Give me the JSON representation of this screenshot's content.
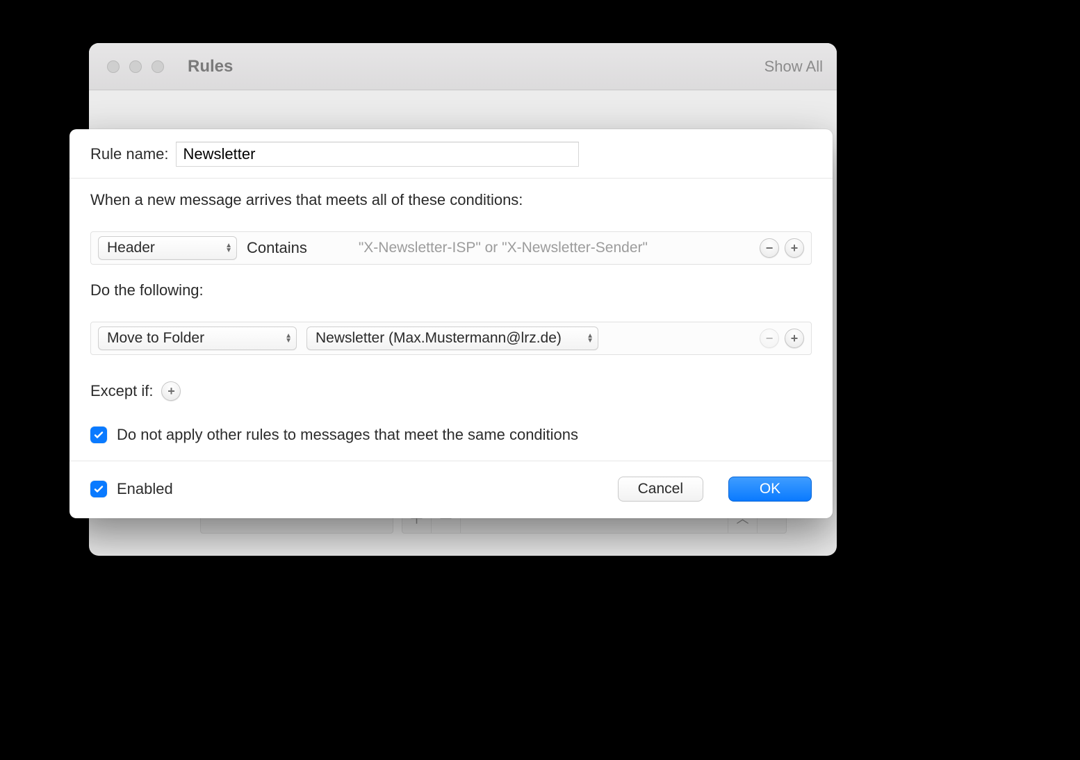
{
  "backWindow": {
    "title": "Rules",
    "showAll": "Show All"
  },
  "ruleName": {
    "label": "Rule name:",
    "value": "Newsletter"
  },
  "conditions": {
    "heading": "When a new message arrives that meets all of these conditions:",
    "rows": [
      {
        "field": "Header",
        "operator": "Contains",
        "placeholder": "\"X-Newsletter-ISP\" or \"X-Newsletter-Sender\""
      }
    ]
  },
  "actions": {
    "heading": "Do the following:",
    "rows": [
      {
        "action": "Move to Folder",
        "target": "Newsletter (Max.Mustermann@lrz.de)"
      }
    ]
  },
  "except": {
    "label": "Except if:"
  },
  "stopProcessing": {
    "checked": true,
    "label": "Do not apply other rules to messages that meet the same conditions"
  },
  "enabled": {
    "checked": true,
    "label": "Enabled"
  },
  "buttons": {
    "cancel": "Cancel",
    "ok": "OK"
  }
}
